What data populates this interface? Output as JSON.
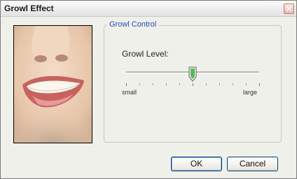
{
  "window": {
    "title": "Growl Effect"
  },
  "group": {
    "legend": "Growl Control"
  },
  "slider": {
    "label": "Growl Level:",
    "min_label": "small",
    "max_label": "large",
    "value_fraction": 0.5,
    "tick_count": 11
  },
  "buttons": {
    "ok": "OK",
    "cancel": "Cancel"
  },
  "icons": {
    "close": "close-icon",
    "slider_thumb": "slider-thumb-icon"
  },
  "colors": {
    "legend_text": "#1f4db3",
    "thumb_fill": "#5cb85c",
    "close_button": "#e26d5a"
  }
}
